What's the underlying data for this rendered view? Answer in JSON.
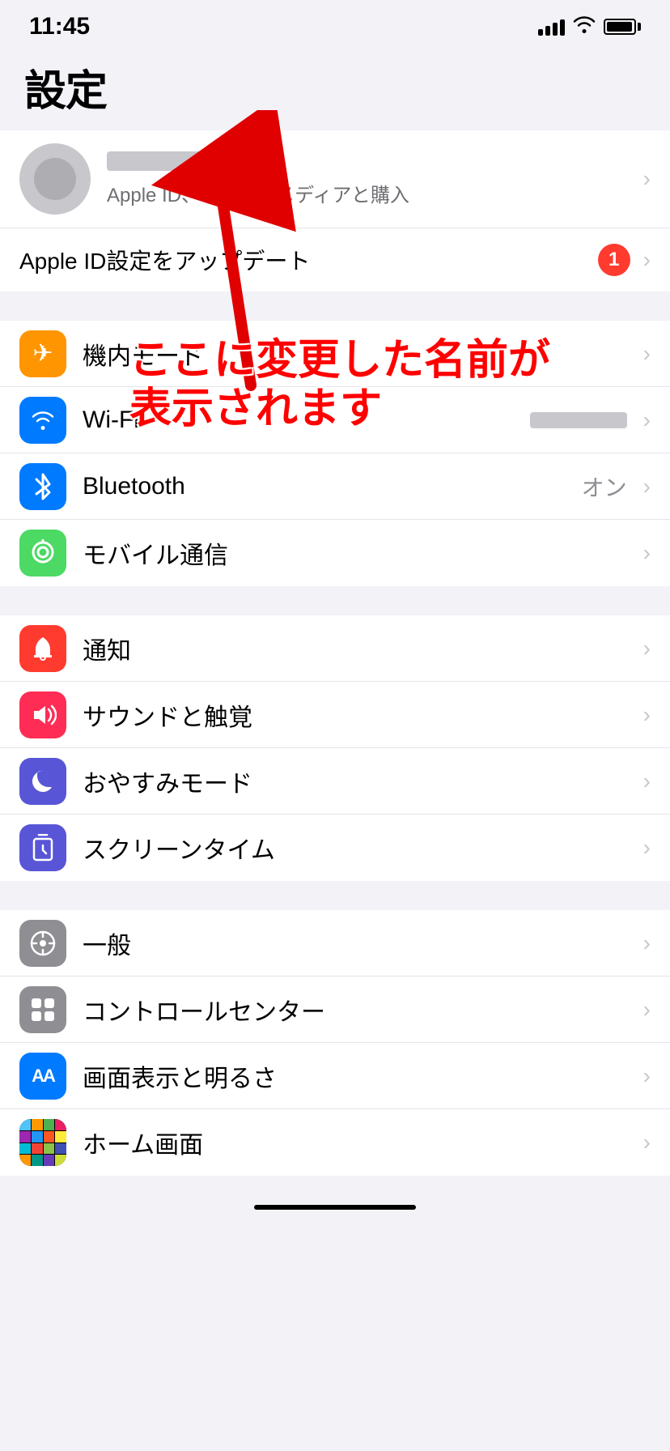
{
  "statusBar": {
    "time": "11:45",
    "battery": 85
  },
  "pageTitle": "設定",
  "profile": {
    "subtitle": "Apple ID、iCloud、メディアと購入",
    "chevron": "›"
  },
  "appleIdUpdate": {
    "label": "Apple ID設定をアップデート",
    "badge": "1"
  },
  "annotation": {
    "line1": "ここに変更した名前が",
    "line2": "表示されます"
  },
  "settingsGroups": [
    {
      "items": [
        {
          "icon": "airplane",
          "label": "機内モード",
          "value": "",
          "iconClass": "icon-airplane",
          "iconSymbol": "✈"
        },
        {
          "icon": "wifi",
          "label": "Wi-Fi",
          "value": "",
          "iconClass": "icon-wifi",
          "iconSymbol": "📶",
          "hasBlurValue": true
        },
        {
          "icon": "bluetooth",
          "label": "Bluetooth",
          "value": "オン",
          "iconClass": "icon-bluetooth",
          "iconSymbol": "⬡"
        },
        {
          "icon": "cellular",
          "label": "モバイル通信",
          "value": "",
          "iconClass": "icon-cellular",
          "iconSymbol": "((·))"
        }
      ]
    },
    {
      "items": [
        {
          "icon": "notifications",
          "label": "通知",
          "value": "",
          "iconClass": "icon-notifications",
          "iconSymbol": "🔔"
        },
        {
          "icon": "sound",
          "label": "サウンドと触覚",
          "value": "",
          "iconClass": "icon-sound",
          "iconSymbol": "🔊"
        },
        {
          "icon": "donotdisturb",
          "label": "おやすみモード",
          "value": "",
          "iconClass": "icon-donotdisturb",
          "iconSymbol": "🌙"
        },
        {
          "icon": "screentime",
          "label": "スクリーンタイム",
          "value": "",
          "iconClass": "icon-screentime",
          "iconSymbol": "⏳"
        }
      ]
    },
    {
      "items": [
        {
          "icon": "general",
          "label": "一般",
          "value": "",
          "iconClass": "icon-general",
          "iconSymbol": "⚙"
        },
        {
          "icon": "controlcenter",
          "label": "コントロールセンター",
          "value": "",
          "iconClass": "icon-controlcenter",
          "iconSymbol": "⊙"
        },
        {
          "icon": "display",
          "label": "画面表示と明るさ",
          "value": "",
          "iconClass": "icon-display",
          "iconSymbol": "AA"
        },
        {
          "icon": "homescreen",
          "label": "ホーム画面",
          "value": "",
          "iconClass": "icon-homescreen",
          "iconSymbol": "⊞"
        }
      ]
    }
  ],
  "chevronChar": "›"
}
